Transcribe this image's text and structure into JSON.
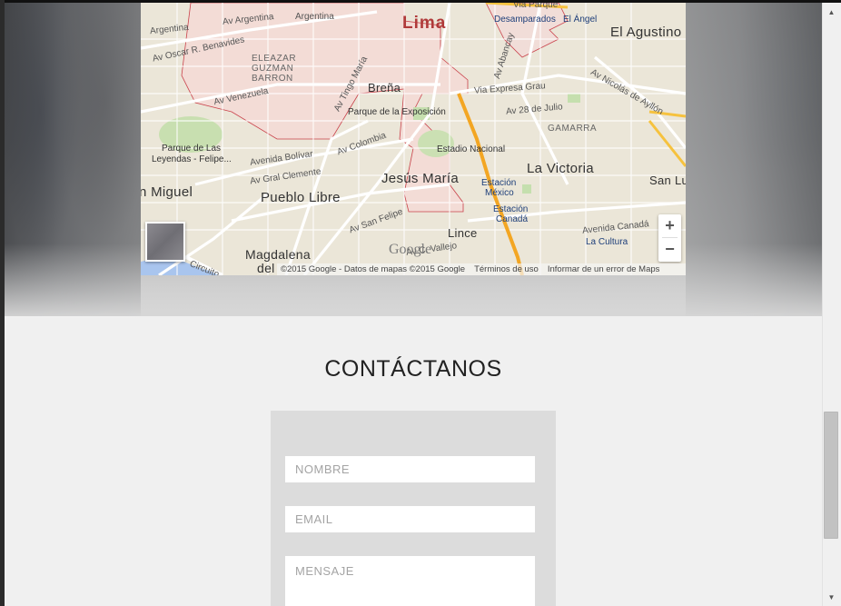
{
  "map": {
    "labels": {
      "capital": "Lima",
      "desamparados": "Desamparados",
      "el_angel": "El Ángel",
      "el_agustino": "El Agustino",
      "via_parque": "Via Parque",
      "argentina_1": "Argentina",
      "argentina_2": "Av Argentina",
      "argentina_3": "Argentina",
      "benavides": "Av Oscar R. Benavides",
      "elezar_1": "ELEAZAR",
      "elezar_2": "GUZMAN",
      "elezar_3": "BARRON",
      "tingo_maria": "Av Tingo María",
      "abancay": "Av Abancay",
      "brena": "Breña",
      "venezuela": "Av Venezuela",
      "via_expresa": "Via Expresa Grau",
      "nicolas": "Av Nicolás de Ayllón",
      "parque_exposicion": "Parque de la Exposición",
      "av_28": "Av 28 de Julio",
      "gamarra": "GAMARRA",
      "parque_leyendas_1": "Parque de Las",
      "parque_leyendas_2": "Leyendas - Felipe...",
      "colombia": "Av Colombia",
      "estadio": "Estadio Nacional",
      "bolivar": "Avenida Bolívar",
      "jesus_maria": "Jesús María",
      "la_victoria": "La Victoria",
      "gral_clemente": "Av Gral Clemente",
      "san_miguel": "n Miguel",
      "pueblo_libre": "Pueblo Libre",
      "estacion_mexico_1": "Estación",
      "estacion_mexico_2": "México",
      "san_luis": "San Lu",
      "estacion_canada_1": "Estación",
      "estacion_canada_2": "Canadá",
      "san_felipe": "Av San Felipe",
      "av_canada": "Avenida Canadá",
      "lince": "Lince",
      "magdalena_1": "Magdalena",
      "magdalena_2": "del",
      "vallejo": "Av C. Vallejo",
      "la_cultura": "La Cultura",
      "circuito": "Circuito"
    },
    "google_logo": "Google",
    "attribution": "©2015 Google - Datos de mapas ©2015 Google",
    "terms": "Términos de uso",
    "report": "Informar de un error de Maps",
    "zoom_in": "+",
    "zoom_out": "−"
  },
  "contact": {
    "title": "CONTÁCTANOS",
    "name_placeholder": "NOMBRE",
    "email_placeholder": "EMAIL",
    "message_placeholder": "MENSAJE"
  },
  "scrollbar": {
    "up_arrow": "▲",
    "down_arrow": "▼"
  }
}
